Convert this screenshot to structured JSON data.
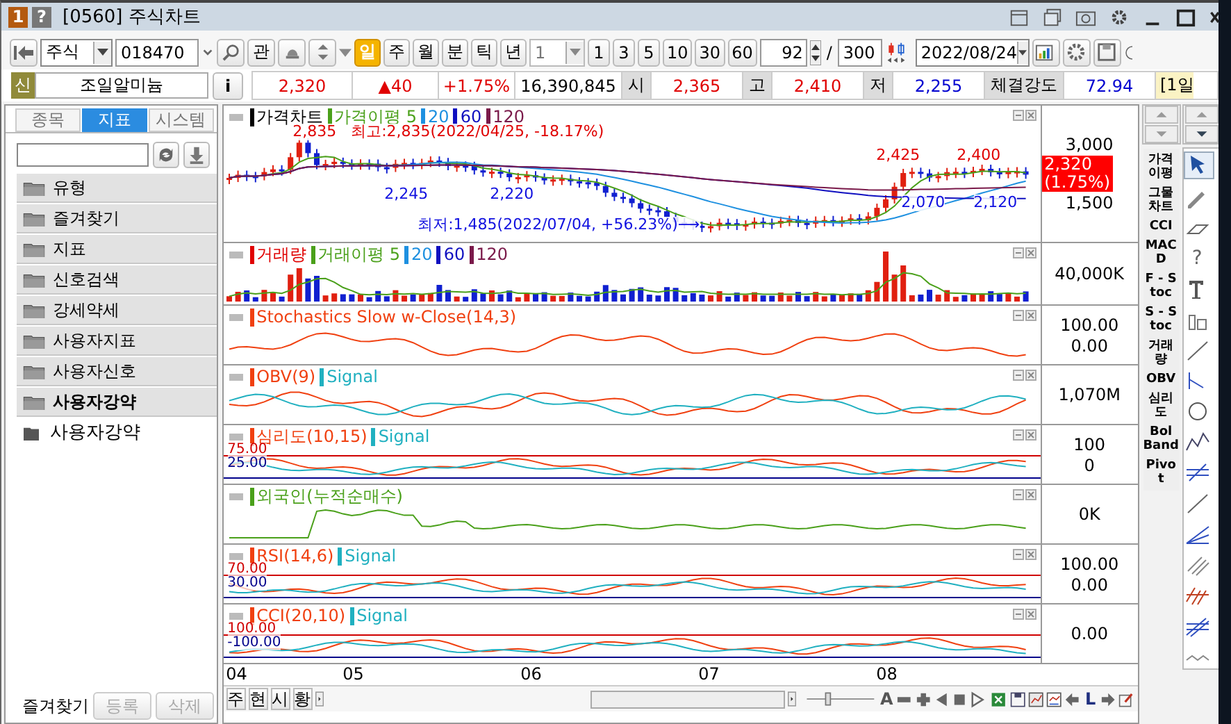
{
  "window": {
    "number_badge": "1",
    "help_badge": "?",
    "title": "[0560] 주식차트"
  },
  "toolbar": {
    "market": "주식",
    "code": "018470",
    "watch_button": "관",
    "periods": [
      {
        "label": "일",
        "selected": true
      },
      {
        "label": "주",
        "selected": false
      },
      {
        "label": "월",
        "selected": false
      },
      {
        "label": "분",
        "selected": false
      },
      {
        "label": "틱",
        "selected": false
      },
      {
        "label": "년",
        "selected": false
      }
    ],
    "interval": "1",
    "minutes": [
      "1",
      "3",
      "5",
      "10",
      "30",
      "60"
    ],
    "count": "92",
    "separator": "/",
    "total": "300",
    "date": "2022/08/24"
  },
  "quote": {
    "badge": "신",
    "name": "조일알미늄",
    "info_button": "i",
    "values": [
      {
        "text": "2,320",
        "color": "#e00000"
      },
      {
        "text": "▲40",
        "color": "#e00000"
      },
      {
        "text": "+1.75%",
        "color": "#e00000"
      },
      {
        "text": "16,390,845",
        "color": "#000000"
      }
    ],
    "fields": [
      {
        "label": "시",
        "value": "2,365",
        "color": "#e00000"
      },
      {
        "label": "고",
        "value": "2,410",
        "color": "#e00000"
      },
      {
        "label": "저",
        "value": "2,255",
        "color": "#0000d0"
      },
      {
        "label": "체결강도",
        "value": "72.94",
        "color": "#0000d0"
      }
    ],
    "period_tag": "[1일"
  },
  "sidebar": {
    "tabs": [
      {
        "label": "종목",
        "selected": false
      },
      {
        "label": "지표",
        "selected": true
      },
      {
        "label": "시스템",
        "selected": false
      }
    ],
    "folders": [
      {
        "label": "유형",
        "selected": false
      },
      {
        "label": "즐겨찾기",
        "selected": false
      },
      {
        "label": "지표",
        "selected": false
      },
      {
        "label": "신호검색",
        "selected": false
      },
      {
        "label": "강세약세",
        "selected": false
      },
      {
        "label": "사용자지표",
        "selected": false
      },
      {
        "label": "사용자신호",
        "selected": false
      },
      {
        "label": "사용자강약",
        "selected": true
      }
    ],
    "tree": [
      {
        "label": "사용자강약"
      }
    ],
    "footer_label": "즐겨찾기",
    "footer_buttons": [
      {
        "label": "등록",
        "disabled": true
      },
      {
        "label": "삭제",
        "disabled": true
      }
    ]
  },
  "chart": {
    "panes": [
      {
        "kind": "price",
        "legend": [
          {
            "text": "가격차트",
            "color": "#000000"
          },
          {
            "text": "가격이평 5",
            "color": "#4aa01a"
          },
          {
            "text": "20",
            "color": "#1e90e0"
          },
          {
            "text": "60",
            "color": "#1010c0"
          },
          {
            "text": "120",
            "color": "#7a1a4a"
          }
        ],
        "annotations": [
          {
            "text": "2,835",
            "color": "#e00000"
          },
          {
            "text": "최고:2,835(2022/04/25, -18.17%)",
            "color": "#e00000"
          },
          {
            "text": "2,245",
            "color": "#1010e0"
          },
          {
            "text": "2,220",
            "color": "#1010e0"
          },
          {
            "text": "최저:1,485(2022/07/04, +56.23%)⟶",
            "color": "#1010e0"
          },
          {
            "text": "2,425",
            "color": "#e00000"
          },
          {
            "text": "2,400",
            "color": "#e00000"
          },
          {
            "text": "2,070",
            "color": "#1010e0"
          },
          {
            "text": "2,120",
            "color": "#1010e0"
          }
        ],
        "axis": [
          "3,000",
          "1,500"
        ],
        "price_tag": [
          "2,320",
          "(1.75%)"
        ]
      },
      {
        "kind": "volume",
        "legend": [
          {
            "text": "거래량",
            "color": "#e00000"
          },
          {
            "text": "거래이평 5",
            "color": "#4aa01a"
          },
          {
            "text": "20",
            "color": "#1e90e0"
          },
          {
            "text": "60",
            "color": "#1010c0"
          },
          {
            "text": "120",
            "color": "#7a1a4a"
          }
        ],
        "axis": [
          "40,000K"
        ]
      },
      {
        "kind": "oscillator",
        "legend": [
          {
            "text": "Stochastics Slow w-Close(14,3)",
            "color": "#f04010"
          }
        ],
        "axis": [
          "100.00",
          "0.00"
        ]
      },
      {
        "kind": "oscillator",
        "legend": [
          {
            "text": "OBV(9)",
            "color": "#f04010"
          },
          {
            "text": "Signal",
            "color": "#20b0c0"
          }
        ],
        "axis": [
          "1,070M"
        ]
      },
      {
        "kind": "band",
        "legend": [
          {
            "text": "심리도(10,15)",
            "color": "#f04010"
          },
          {
            "text": "Signal",
            "color": "#20b0c0"
          }
        ],
        "levels": [
          {
            "text": "75.00",
            "color": "#d00000"
          },
          {
            "text": "25.00",
            "color": "#00008b"
          }
        ],
        "axis": [
          "100",
          "0"
        ]
      },
      {
        "kind": "cumulative",
        "legend": [
          {
            "text": "외국인(누적순매수)",
            "color": "#4aa01a"
          }
        ],
        "axis": [
          "0K"
        ]
      },
      {
        "kind": "band",
        "legend": [
          {
            "text": "RSI(14,6)",
            "color": "#f04010"
          },
          {
            "text": "Signal",
            "color": "#20b0c0"
          }
        ],
        "levels": [
          {
            "text": "70.00",
            "color": "#d00000"
          },
          {
            "text": "30.00",
            "color": "#00008b"
          }
        ],
        "axis": [
          "100.00",
          "0.00"
        ]
      },
      {
        "kind": "band",
        "legend": [
          {
            "text": "CCI(20,10)",
            "color": "#f04010"
          },
          {
            "text": "Signal",
            "color": "#20b0c0"
          }
        ],
        "levels": [
          {
            "text": "100.00",
            "color": "#d00000"
          },
          {
            "text": "-100.00",
            "color": "#00008b"
          }
        ],
        "axis": [
          "0.00"
        ]
      }
    ],
    "x_axis": [
      "04",
      "05",
      "06",
      "07",
      "08"
    ]
  },
  "bottom_bar": {
    "tabs": [
      "주",
      "현",
      "시",
      "황"
    ],
    "zoom": {
      "level": 0.3
    },
    "font_button": "A",
    "latest_button": "L"
  },
  "indicator_buttons": [
    "가격이평",
    "그물차트",
    "CCI",
    "MACD",
    "F - Stoc",
    "S - Stoc",
    "거래량",
    "OBV",
    "심리도",
    "Bol Band",
    "Pivot"
  ],
  "tools_help": "?"
}
